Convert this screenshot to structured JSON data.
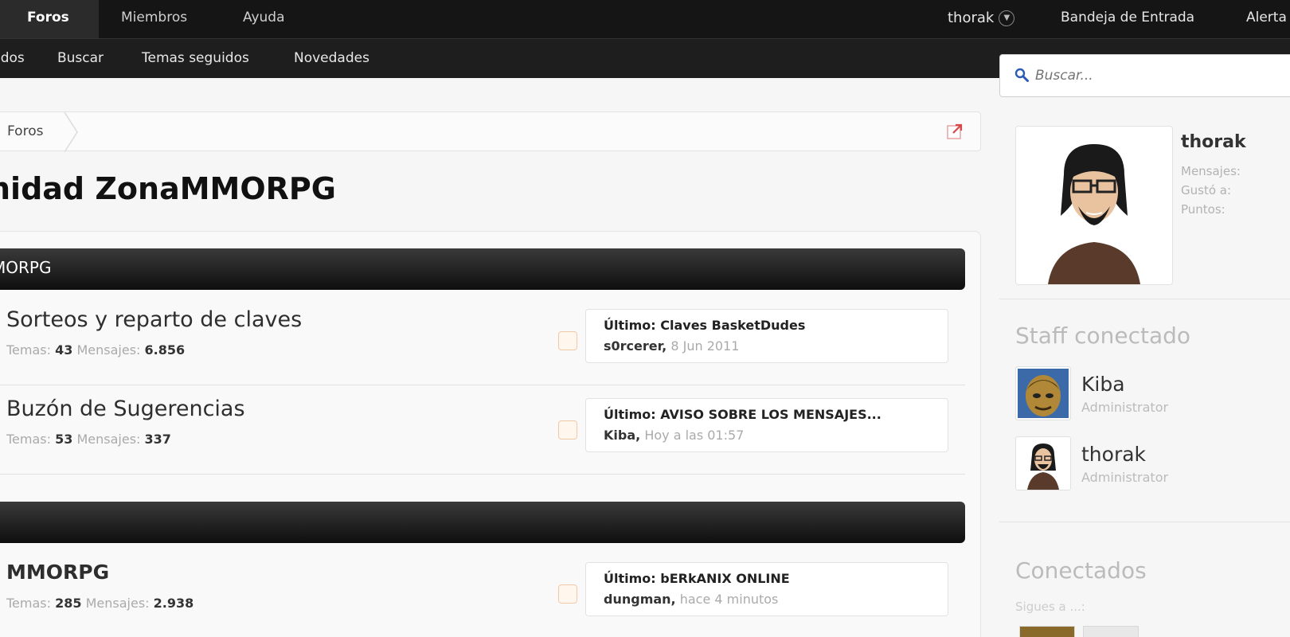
{
  "nav": {
    "tabs": [
      "Foros",
      "Miembros",
      "Ayuda"
    ],
    "user": "thorak",
    "inbox": "Bandeja de Entrada",
    "alerts": "Alerta"
  },
  "subnav": [
    "idos",
    "Buscar",
    "Temas seguidos",
    "Novedades"
  ],
  "search": {
    "placeholder": "Buscar..."
  },
  "breadcrumb": {
    "item": "Foros"
  },
  "page_title": "nidad ZonaMMORPG",
  "categories": [
    {
      "title": "MORPG",
      "forums": [
        {
          "title": "Sorteos y reparto de claves",
          "temas_label": "Temas:",
          "temas": "43",
          "mensajes_label": "Mensajes:",
          "mensajes": "6.856",
          "last_label": "Último:",
          "last_title": "Claves BasketDudes",
          "last_user": "s0rcerer,",
          "last_date": "8 Jun 2011"
        },
        {
          "title": "Buzón de Sugerencias",
          "temas_label": "Temas:",
          "temas": "53",
          "mensajes_label": "Mensajes:",
          "mensajes": "337",
          "last_label": "Último:",
          "last_title": "AVISO SOBRE LOS MENSAJES...",
          "last_user": "Kiba,",
          "last_date": "Hoy a las 01:57"
        }
      ]
    },
    {
      "title": "",
      "forums": [
        {
          "title": "MMORPG",
          "temas_label": "Temas:",
          "temas": "285",
          "mensajes_label": "Mensajes:",
          "mensajes": "2.938",
          "last_label": "Último:",
          "last_title": "bERkANIX ONLINE",
          "last_user": "dungman,",
          "last_date": "hace 4 minutos"
        }
      ]
    }
  ],
  "sidebar": {
    "profile": {
      "name": "thorak",
      "mensajes": "Mensajes:",
      "gusto": "Gustó a:",
      "puntos": "Puntos:"
    },
    "staff_heading": "Staff conectado",
    "staff": [
      {
        "name": "Kiba",
        "role": "Administrator"
      },
      {
        "name": "thorak",
        "role": "Administrator"
      }
    ],
    "online_heading": "Conectados",
    "following": "Sigues a ...:"
  }
}
